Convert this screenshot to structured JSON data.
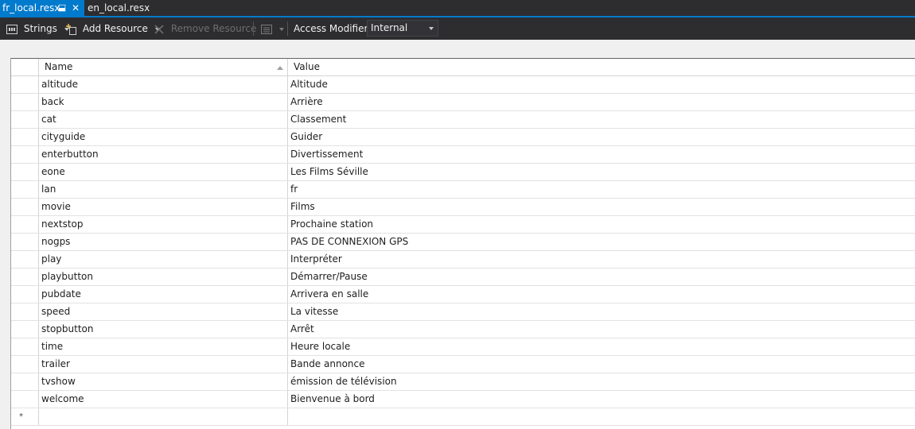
{
  "tabs": [
    {
      "label": "fr_local.resx",
      "pin": "⬓",
      "close": "✕"
    },
    {
      "label": "en_local.resx"
    }
  ],
  "toolbar": {
    "strings_label": "Strings",
    "add_resource_label": "Add Resource",
    "remove_resource_label": "Remove Resource",
    "access_modifier_label": "Access Modifier:",
    "access_modifier_value": "Internal"
  },
  "grid": {
    "headers": {
      "name": "Name",
      "value": "Value"
    },
    "new_row_marker": "*",
    "rows": [
      {
        "name": "altitude",
        "value": "Altitude"
      },
      {
        "name": "back",
        "value": "Arrière"
      },
      {
        "name": "cat",
        "value": "Classement"
      },
      {
        "name": "cityguide",
        "value": "Guider"
      },
      {
        "name": "enterbutton",
        "value": "Divertissement"
      },
      {
        "name": "eone",
        "value": "Les Films Séville"
      },
      {
        "name": "lan",
        "value": "fr"
      },
      {
        "name": "movie",
        "value": "Films"
      },
      {
        "name": "nextstop",
        "value": "Prochaine station"
      },
      {
        "name": "nogps",
        "value": "PAS DE CONNEXION GPS"
      },
      {
        "name": "play",
        "value": "Interpréter"
      },
      {
        "name": "playbutton",
        "value": "Démarrer/Pause"
      },
      {
        "name": "pubdate",
        "value": "Arrivera en salle"
      },
      {
        "name": "speed",
        "value": "La vitesse"
      },
      {
        "name": "stopbutton",
        "value": "Arrêt"
      },
      {
        "name": "time",
        "value": "Heure locale"
      },
      {
        "name": "trailer",
        "value": "Bande annonce"
      },
      {
        "name": "tvshow",
        "value": "émission de télévision"
      },
      {
        "name": "welcome",
        "value": "Bienvenue à bord"
      }
    ]
  }
}
